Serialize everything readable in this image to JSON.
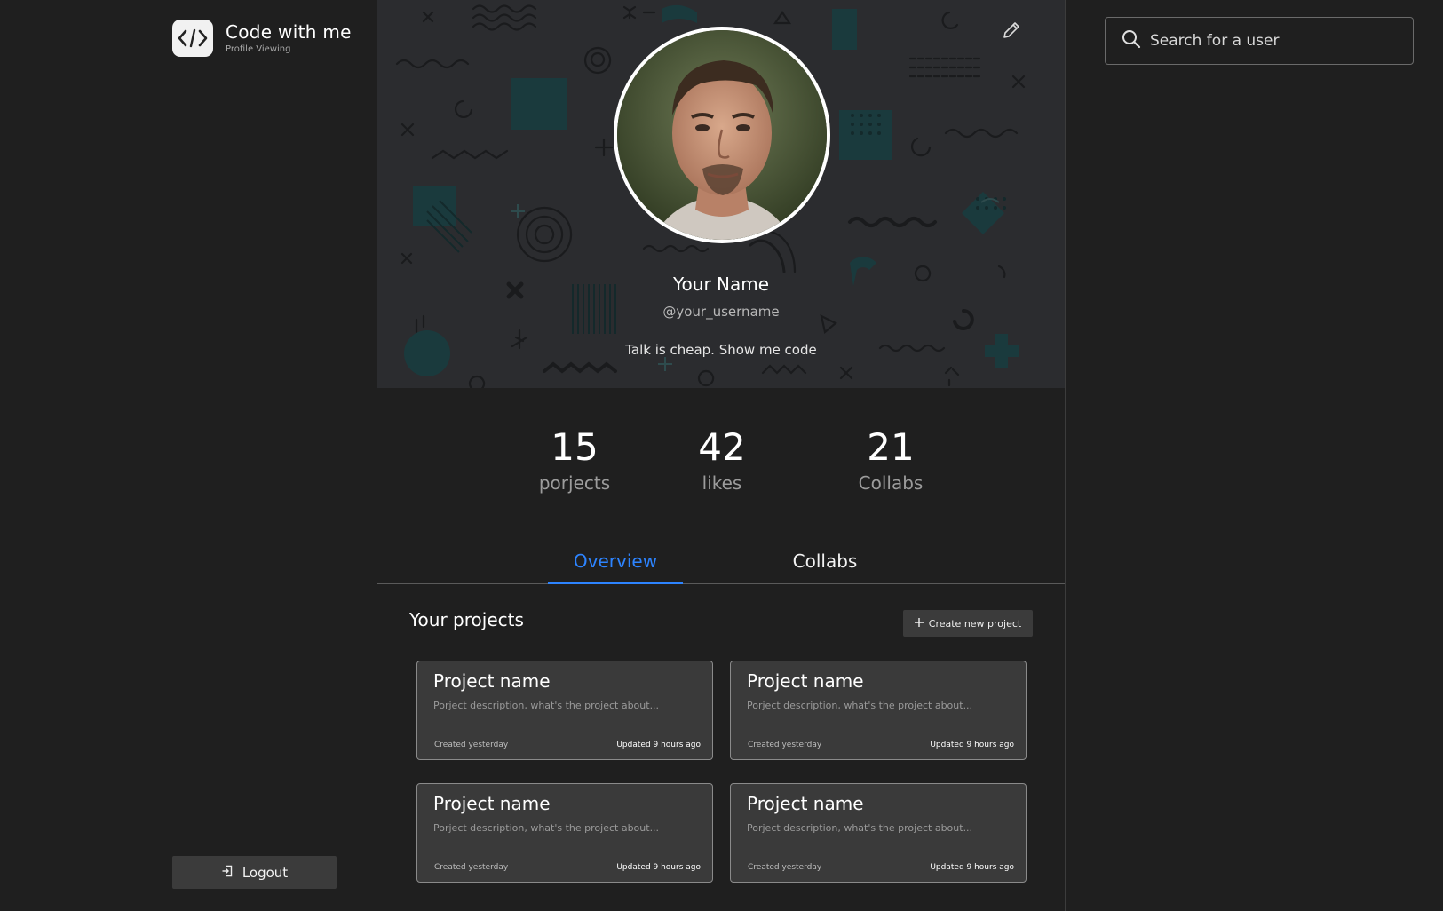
{
  "brand": {
    "title": "Code with me",
    "subtitle": "Profile Viewing",
    "logo_icon": "code-brackets-icon"
  },
  "sidebar": {
    "logout_label": "Logout",
    "logout_icon": "logout-icon"
  },
  "profile": {
    "name": "Your Name",
    "username": "@your_username",
    "bio": "Talk is cheap. Show me code",
    "edit_icon": "pencil-icon"
  },
  "stats": [
    {
      "value": "15",
      "label": "porjects"
    },
    {
      "value": "42",
      "label": "likes"
    },
    {
      "value": "21",
      "label": "Collabs"
    }
  ],
  "tabs": [
    {
      "label": "Overview",
      "active": true
    },
    {
      "label": "Collabs",
      "active": false
    }
  ],
  "projects": {
    "title": "Your projects",
    "create_label": "Create new project",
    "items": [
      {
        "name": "Project name",
        "description": "Porject description, what's the project about...",
        "created": "Created yesterday",
        "updated": "Updated 9 hours ago"
      },
      {
        "name": "Project name",
        "description": "Porject description, what's the project about...",
        "created": "Created yesterday",
        "updated": "Updated 9 hours ago"
      },
      {
        "name": "Project name",
        "description": "Porject description, what's the project about...",
        "created": "Created yesterday",
        "updated": "Updated 9 hours ago"
      },
      {
        "name": "Project name",
        "description": "Porject description, what's the project about...",
        "created": "Created yesterday",
        "updated": "Updated 9 hours ago"
      }
    ]
  },
  "search": {
    "placeholder": "Search for a user",
    "icon": "search-icon"
  },
  "colors": {
    "background": "#1f1f1f",
    "hero": "#2b2c2f",
    "accent": "#2d84ff",
    "card": "#3a3a3a",
    "button": "#3b3b3b"
  }
}
